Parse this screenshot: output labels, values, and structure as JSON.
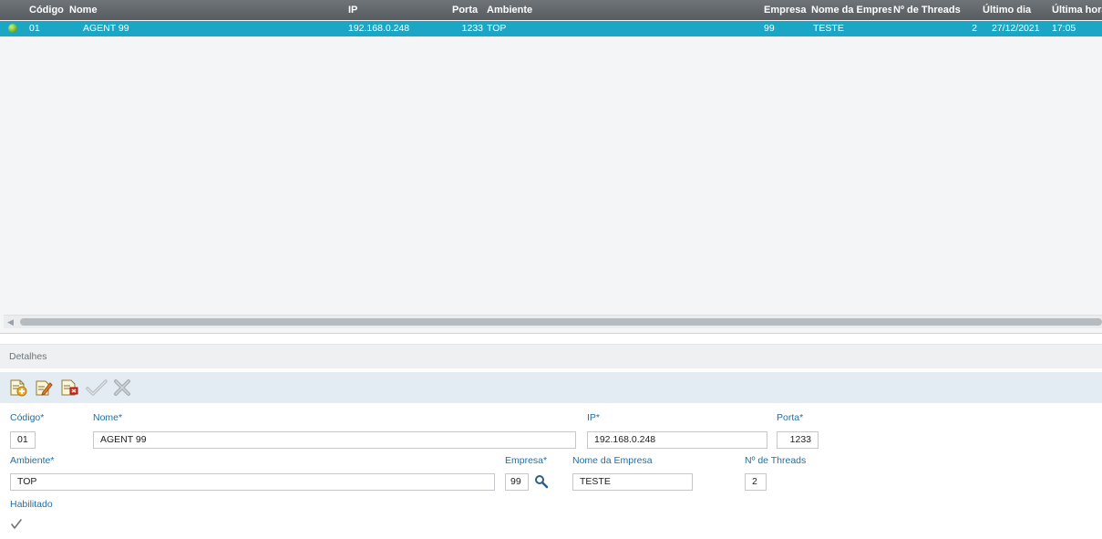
{
  "grid": {
    "columns": [
      "Código",
      "Nome",
      "IP",
      "Porta",
      "Ambiente",
      "Empresa",
      "Nome da Empres",
      "Nº de Threads",
      "Último dia",
      "Última hora"
    ],
    "rows": [
      {
        "status_color": "#6db52a",
        "codigo": "01",
        "nome": "AGENT 99",
        "ip": "192.168.0.248",
        "porta": "1233",
        "ambiente": "TOP",
        "empresa": "99",
        "nome_empresa": "TESTE",
        "threads": "2",
        "ultimo_dia": "27/12/2021",
        "ultima_hora": "17:05"
      }
    ],
    "selected_row_color": "#1aa6c4"
  },
  "details": {
    "title": "Detalhes",
    "toolbar_icons": [
      "add-document-icon",
      "edit-document-icon",
      "delete-document-icon",
      "checkmark-icon",
      "close-icon"
    ],
    "labels": {
      "codigo": "Código*",
      "nome": "Nome*",
      "ip": "IP*",
      "porta": "Porta*",
      "ambiente": "Ambiente*",
      "empresa": "Empresa*",
      "nome_empresa": "Nome da Empresa",
      "threads": "Nº de Threads",
      "habilitado": "Habilitado"
    },
    "values": {
      "codigo": "01",
      "nome": "AGENT 99",
      "ip": "192.168.0.248",
      "porta": "1233",
      "ambiente": "TOP",
      "empresa": "99",
      "nome_empresa": "TESTE",
      "threads": "2",
      "habilitado": true
    },
    "label_color": "#1f6fa6"
  }
}
